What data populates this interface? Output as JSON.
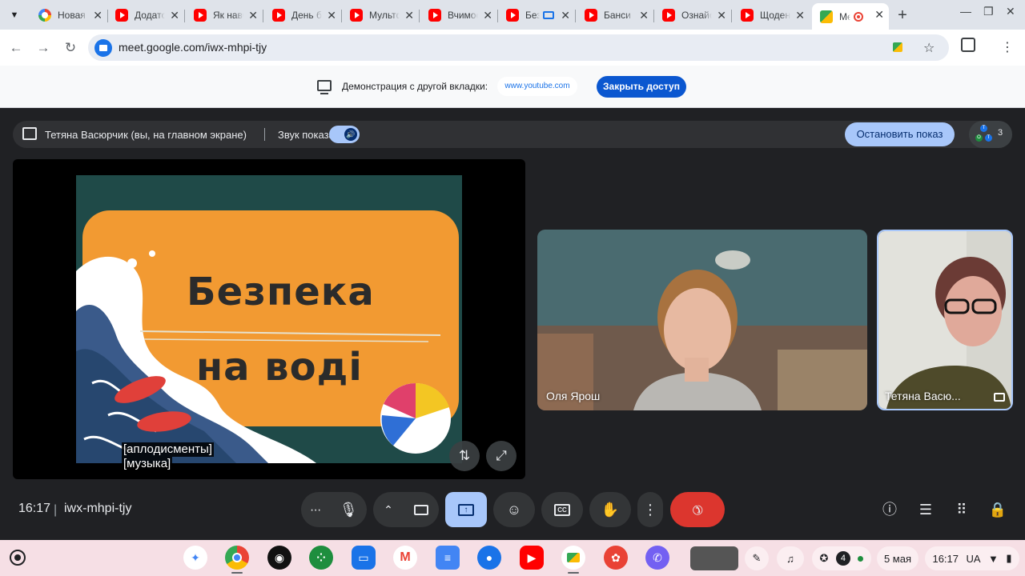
{
  "browser": {
    "tabs": [
      {
        "title": "Новая вкладка",
        "icon": "chrome-icon",
        "active": false
      },
      {
        "title": "Додаток",
        "icon": "youtube-icon",
        "active": false
      },
      {
        "title": "Як навчитися",
        "icon": "youtube-icon",
        "active": false
      },
      {
        "title": "День безпеки",
        "icon": "youtube-icon",
        "active": false
      },
      {
        "title": "Мультфільм",
        "icon": "youtube-icon",
        "active": false
      },
      {
        "title": "Вчимося",
        "icon": "youtube-icon",
        "active": false
      },
      {
        "title": "Безпека",
        "icon": "youtube-icon",
        "active": false
      },
      {
        "title": "Банси",
        "icon": "youtube-icon",
        "active": false
      },
      {
        "title": "Ознайомлення",
        "icon": "youtube-icon",
        "active": false
      },
      {
        "title": "Щоденник",
        "icon": "youtube-icon",
        "active": false
      },
      {
        "title": "Meet",
        "icon": "meet-icon",
        "active": true
      }
    ],
    "url": "meet.google.com/iwx-mhpi-tjy"
  },
  "infobar": {
    "text": "Демонстрация с другой вкладки:",
    "source_site": "www.youtube.com",
    "stop_access_label": "Закрыть доступ"
  },
  "presenting_bar": {
    "presenter_text": "Тетяна Васюрчик (вы, на главном экране)",
    "sound_label": "Звук показа",
    "sound_enabled": true,
    "stop_label": "Остановить показ",
    "participants_count": "3",
    "avatar_letters": [
      "Т",
      "О",
      "Т"
    ]
  },
  "slide": {
    "title_line1": "Безпека",
    "title_line2": "на воді"
  },
  "captions": [
    "[аплодисменты]",
    "[музыка]"
  ],
  "participants": [
    {
      "name": "Оля Ярош"
    },
    {
      "name": "Тетяна Васю..."
    }
  ],
  "footer": {
    "time": "16:17",
    "separator": "|",
    "meeting_code": "iwx-mhpi-tjy"
  },
  "shelf": {
    "notifications_count": "4",
    "date": "5 мая",
    "time": "16:17",
    "locale": "UA"
  },
  "colors": {
    "meet_bg": "#202124",
    "accent_blue": "#a8c7fa",
    "end_call_red": "#ea4335",
    "slide_orange": "#f29a32",
    "slide_teal": "#1f4a48",
    "shelf_bg": "#f6dfe5"
  }
}
